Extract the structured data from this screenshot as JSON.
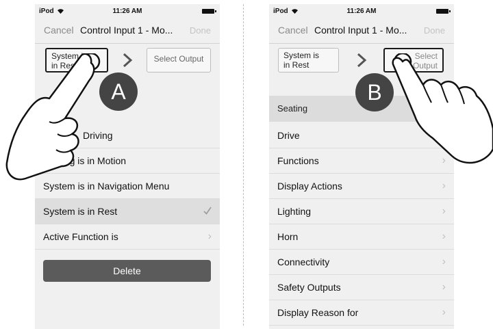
{
  "status": {
    "device": "iPod",
    "time": "11:26 AM"
  },
  "nav": {
    "cancel": "Cancel",
    "title": "Control Input 1 - Mo...",
    "done": "Done"
  },
  "panelA": {
    "input_label": "System is\nin Rest",
    "output_label": "Select Output",
    "badge": "A",
    "rows": [
      {
        "label": "Driving"
      },
      {
        "label": "ating is in Motion"
      },
      {
        "label": "System is in Navigation Menu"
      },
      {
        "label": "System is in Rest",
        "selected": true
      },
      {
        "label": "Active Function is"
      }
    ],
    "delete_label": "Delete"
  },
  "panelB": {
    "input_label": "System is\nin Rest",
    "output_label": "Select\nOutput",
    "badge": "B",
    "section_header": "Seating",
    "rows": [
      {
        "label": "Drive"
      },
      {
        "label": "Functions"
      },
      {
        "label": "Display Actions"
      },
      {
        "label": "Lighting"
      },
      {
        "label": "Horn"
      },
      {
        "label": "Connectivity"
      },
      {
        "label": "Safety Outputs"
      },
      {
        "label": "Display Reason for"
      }
    ]
  },
  "icons": {
    "chevron": "›",
    "check": "check-icon",
    "wifi": "wifi-icon",
    "battery": "battery-icon"
  }
}
